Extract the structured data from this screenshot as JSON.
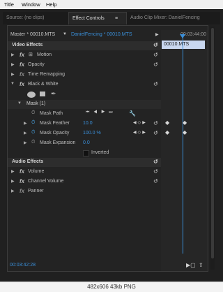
{
  "menu": [
    "Title",
    "Window",
    "Help"
  ],
  "tabs": [
    {
      "label": "Source: (no clips)"
    },
    {
      "label": "Effect Controls",
      "menu_icon": "≡"
    },
    {
      "label": "Audio Clip Mixer: DanielFencing"
    }
  ],
  "header": {
    "master_label": "Master * 00010.MTS",
    "sequence_label": "DanielFencing * 00010.MTS",
    "timecode": "00:03:44:00"
  },
  "clip_name": "00010.MTS",
  "video_effects": {
    "title": "Video Effects",
    "items": [
      "Motion",
      "Opacity",
      "Time Remapping",
      "Black & White"
    ]
  },
  "mask": {
    "title": "Mask (1)",
    "path_label": "Mask Path",
    "feather_label": "Mask Feather",
    "feather_value": "10.0",
    "opacity_label": "Mask Opacity",
    "opacity_value": "100.0 %",
    "expansion_label": "Mask Expansion",
    "expansion_value": "0.0",
    "inverted_label": "Inverted"
  },
  "audio_effects": {
    "title": "Audio Effects",
    "items": [
      "Volume",
      "Channel Volume",
      "Panner"
    ]
  },
  "footer_timecode": "00:03:42:28",
  "bottom_caption": "482x606 43kb PNG",
  "colors": {
    "accent": "#3a8fd9",
    "panel": "#232323",
    "clip": "#c9d7ef"
  }
}
